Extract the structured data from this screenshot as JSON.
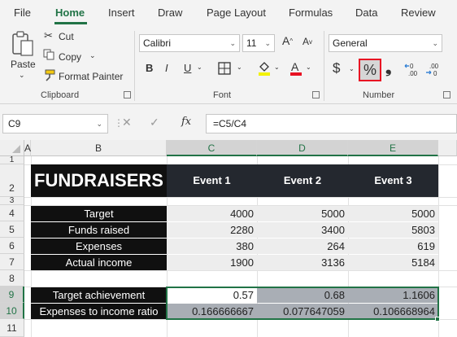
{
  "menu": {
    "tabs": [
      "File",
      "Home",
      "Insert",
      "Draw",
      "Page Layout",
      "Formulas",
      "Data",
      "Review"
    ],
    "active": "Home"
  },
  "ribbon": {
    "clipboard": {
      "paste_label": "Paste",
      "cut_label": "Cut",
      "copy_label": "Copy",
      "format_painter_label": "Format Painter",
      "group_label": "Clipboard"
    },
    "font": {
      "font_name": "Calibri",
      "font_size": "11",
      "bold": "B",
      "italic": "I",
      "underline": "U",
      "group_label": "Font"
    },
    "number": {
      "format": "General",
      "currency_symbol": "$",
      "percent_symbol": "%",
      "comma_symbol": "9",
      "group_label": "Number",
      "highlight_color": "#e81123"
    }
  },
  "formula_bar": {
    "name_box": "C9",
    "fx": "fx",
    "formula": "=C5/C4"
  },
  "sheet": {
    "columns": [
      "A",
      "B",
      "C",
      "D",
      "E"
    ],
    "rows": [
      "1",
      "2",
      "3",
      "4",
      "5",
      "6",
      "7",
      "8",
      "9",
      "10",
      "11"
    ],
    "title": "FUNDRAISERS",
    "event_headers": [
      "Event 1",
      "Event 2",
      "Event 3"
    ],
    "data_rows": [
      {
        "label": "Target",
        "values": [
          "4000",
          "5000",
          "5000"
        ]
      },
      {
        "label": "Funds raised",
        "values": [
          "2280",
          "3400",
          "5803"
        ]
      },
      {
        "label": "Expenses",
        "values": [
          "380",
          "264",
          "619"
        ]
      },
      {
        "label": "Actual income",
        "values": [
          "1900",
          "3136",
          "5184"
        ]
      }
    ],
    "ratio_rows": [
      {
        "label": "Target achievement",
        "values": [
          "0.57",
          "0.68",
          "1.1606"
        ]
      },
      {
        "label": "Expenses to income ratio",
        "values": [
          "0.166666667",
          "0.077647059",
          "0.106668964"
        ]
      }
    ],
    "accent_color": "#217346"
  }
}
